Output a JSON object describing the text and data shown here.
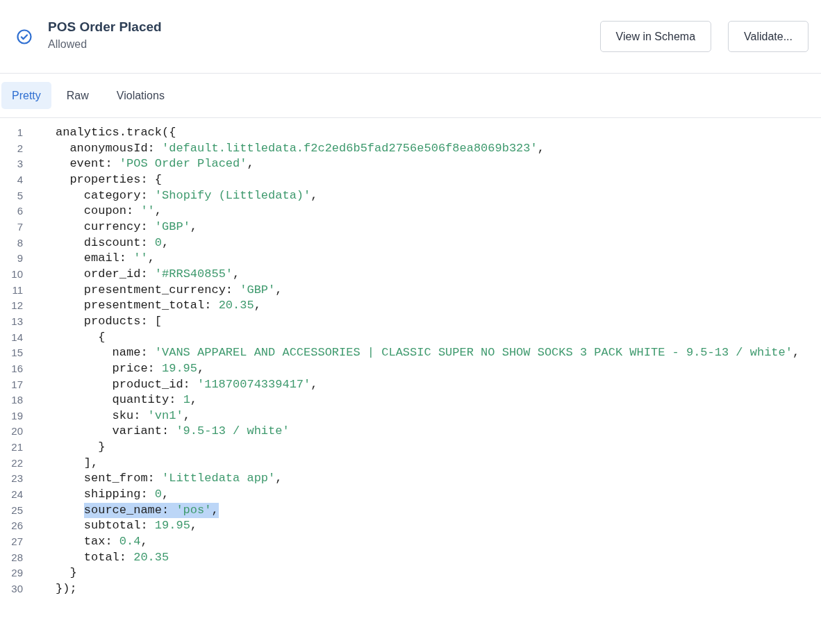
{
  "header": {
    "title": "POS Order Placed",
    "status": "Allowed",
    "buttons": [
      "View in Schema",
      "Validate..."
    ]
  },
  "tabs": [
    {
      "label": "Pretty",
      "selected": true
    },
    {
      "label": "Raw",
      "selected": false
    },
    {
      "label": "Violations",
      "selected": false
    }
  ],
  "code": [
    {
      "number": "1",
      "highlighted": false,
      "parts": [
        {
          "kind": "plain",
          "text": "analytics.track({"
        }
      ]
    },
    {
      "number": "2",
      "highlighted": false,
      "parts": [
        {
          "kind": "plain",
          "text": "  anonymousId: "
        },
        {
          "kind": "value",
          "text": "'default.littledata.f2c2ed6b5fad2756e506f8ea8069b323'"
        },
        {
          "kind": "plain",
          "text": ","
        }
      ]
    },
    {
      "number": "3",
      "highlighted": false,
      "parts": [
        {
          "kind": "plain",
          "text": "  event: "
        },
        {
          "kind": "value",
          "text": "'POS Order Placed'"
        },
        {
          "kind": "plain",
          "text": ","
        }
      ]
    },
    {
      "number": "4",
      "highlighted": false,
      "parts": [
        {
          "kind": "plain",
          "text": "  properties: {"
        }
      ]
    },
    {
      "number": "5",
      "highlighted": false,
      "parts": [
        {
          "kind": "plain",
          "text": "    category: "
        },
        {
          "kind": "value",
          "text": "'Shopify (Littledata)'"
        },
        {
          "kind": "plain",
          "text": ","
        }
      ]
    },
    {
      "number": "6",
      "highlighted": false,
      "parts": [
        {
          "kind": "plain",
          "text": "    coupon: "
        },
        {
          "kind": "value",
          "text": "''"
        },
        {
          "kind": "plain",
          "text": ","
        }
      ]
    },
    {
      "number": "7",
      "highlighted": false,
      "parts": [
        {
          "kind": "plain",
          "text": "    currency: "
        },
        {
          "kind": "value",
          "text": "'GBP'"
        },
        {
          "kind": "plain",
          "text": ","
        }
      ]
    },
    {
      "number": "8",
      "highlighted": false,
      "parts": [
        {
          "kind": "plain",
          "text": "    discount: "
        },
        {
          "kind": "value",
          "text": "0"
        },
        {
          "kind": "plain",
          "text": ","
        }
      ]
    },
    {
      "number": "9",
      "highlighted": false,
      "parts": [
        {
          "kind": "plain",
          "text": "    email: "
        },
        {
          "kind": "value",
          "text": "''"
        },
        {
          "kind": "plain",
          "text": ","
        }
      ]
    },
    {
      "number": "10",
      "highlighted": false,
      "parts": [
        {
          "kind": "plain",
          "text": "    order_id: "
        },
        {
          "kind": "value",
          "text": "'#RRS40855'"
        },
        {
          "kind": "plain",
          "text": ","
        }
      ]
    },
    {
      "number": "11",
      "highlighted": false,
      "parts": [
        {
          "kind": "plain",
          "text": "    presentment_currency: "
        },
        {
          "kind": "value",
          "text": "'GBP'"
        },
        {
          "kind": "plain",
          "text": ","
        }
      ]
    },
    {
      "number": "12",
      "highlighted": false,
      "parts": [
        {
          "kind": "plain",
          "text": "    presentment_total: "
        },
        {
          "kind": "value",
          "text": "20.35"
        },
        {
          "kind": "plain",
          "text": ","
        }
      ]
    },
    {
      "number": "13",
      "highlighted": false,
      "parts": [
        {
          "kind": "plain",
          "text": "    products: ["
        }
      ]
    },
    {
      "number": "14",
      "highlighted": false,
      "parts": [
        {
          "kind": "plain",
          "text": "      {"
        }
      ]
    },
    {
      "number": "15",
      "highlighted": false,
      "parts": [
        {
          "kind": "plain",
          "text": "        name: "
        },
        {
          "kind": "value",
          "text": "'VANS APPAREL AND ACCESSORIES | CLASSIC SUPER NO SHOW SOCKS 3 PACK WHITE - 9.5-13 / white'"
        },
        {
          "kind": "plain",
          "text": ","
        }
      ]
    },
    {
      "number": "16",
      "highlighted": false,
      "parts": [
        {
          "kind": "plain",
          "text": "        price: "
        },
        {
          "kind": "value",
          "text": "19.95"
        },
        {
          "kind": "plain",
          "text": ","
        }
      ]
    },
    {
      "number": "17",
      "highlighted": false,
      "parts": [
        {
          "kind": "plain",
          "text": "        product_id: "
        },
        {
          "kind": "value",
          "text": "'11870074339417'"
        },
        {
          "kind": "plain",
          "text": ","
        }
      ]
    },
    {
      "number": "18",
      "highlighted": false,
      "parts": [
        {
          "kind": "plain",
          "text": "        quantity: "
        },
        {
          "kind": "value",
          "text": "1"
        },
        {
          "kind": "plain",
          "text": ","
        }
      ]
    },
    {
      "number": "19",
      "highlighted": false,
      "parts": [
        {
          "kind": "plain",
          "text": "        sku: "
        },
        {
          "kind": "value",
          "text": "'vn1'"
        },
        {
          "kind": "plain",
          "text": ","
        }
      ]
    },
    {
      "number": "20",
      "highlighted": false,
      "parts": [
        {
          "kind": "plain",
          "text": "        variant: "
        },
        {
          "kind": "value",
          "text": "'9.5-13 / white'"
        }
      ]
    },
    {
      "number": "21",
      "highlighted": false,
      "parts": [
        {
          "kind": "plain",
          "text": "      }"
        }
      ]
    },
    {
      "number": "22",
      "highlighted": false,
      "parts": [
        {
          "kind": "plain",
          "text": "    ],"
        }
      ]
    },
    {
      "number": "23",
      "highlighted": false,
      "parts": [
        {
          "kind": "plain",
          "text": "    sent_from: "
        },
        {
          "kind": "value",
          "text": "'Littledata app'"
        },
        {
          "kind": "plain",
          "text": ","
        }
      ]
    },
    {
      "number": "24",
      "highlighted": false,
      "parts": [
        {
          "kind": "plain",
          "text": "    shipping: "
        },
        {
          "kind": "value",
          "text": "0"
        },
        {
          "kind": "plain",
          "text": ","
        }
      ]
    },
    {
      "number": "25",
      "highlighted": true,
      "parts": [
        {
          "kind": "plain",
          "text": "    source_name: "
        },
        {
          "kind": "value",
          "text": "'pos'"
        },
        {
          "kind": "plain",
          "text": ","
        }
      ]
    },
    {
      "number": "26",
      "highlighted": false,
      "parts": [
        {
          "kind": "plain",
          "text": "    subtotal: "
        },
        {
          "kind": "value",
          "text": "19.95"
        },
        {
          "kind": "plain",
          "text": ","
        }
      ]
    },
    {
      "number": "27",
      "highlighted": false,
      "parts": [
        {
          "kind": "plain",
          "text": "    tax: "
        },
        {
          "kind": "value",
          "text": "0.4"
        },
        {
          "kind": "plain",
          "text": ","
        }
      ]
    },
    {
      "number": "28",
      "highlighted": false,
      "parts": [
        {
          "kind": "plain",
          "text": "    total: "
        },
        {
          "kind": "value",
          "text": "20.35"
        }
      ]
    },
    {
      "number": "29",
      "highlighted": false,
      "parts": [
        {
          "kind": "plain",
          "text": "  }"
        }
      ]
    },
    {
      "number": "30",
      "highlighted": false,
      "parts": [
        {
          "kind": "plain",
          "text": "});"
        }
      ]
    }
  ]
}
